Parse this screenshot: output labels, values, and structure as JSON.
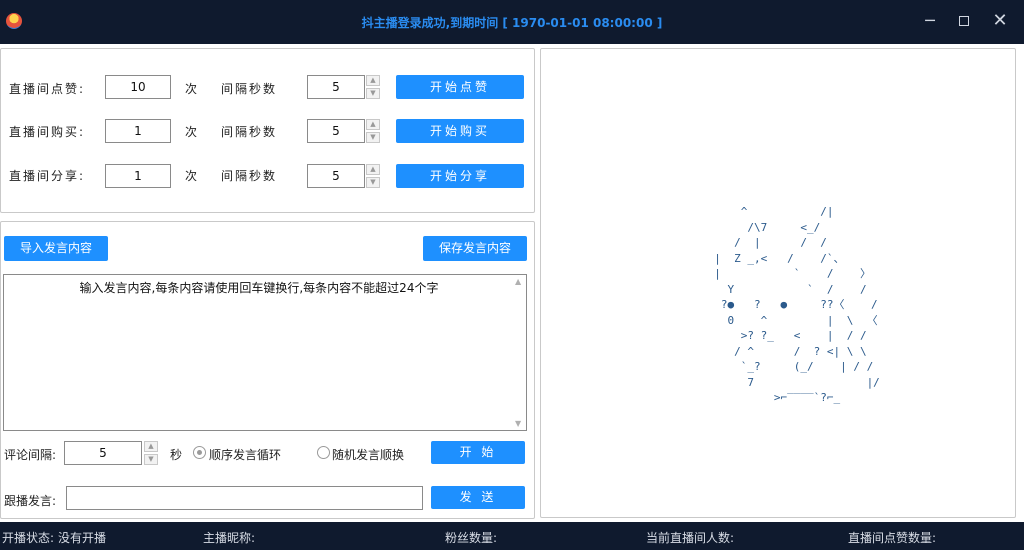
{
  "window": {
    "title": "抖主播登录成功,到期时间 [ 1970-01-01 08:00:00 ]",
    "minimize": "─",
    "close": "✕"
  },
  "controls": {
    "like": {
      "label": "直播间点赞:",
      "count": "10",
      "unit": "次",
      "interval_label": "间隔秒数",
      "interval": "5",
      "button": "开始点赞"
    },
    "buy": {
      "label": "直播间购买:",
      "count": "1",
      "unit": "次",
      "interval_label": "间隔秒数",
      "interval": "5",
      "button": "开始购买"
    },
    "share": {
      "label": "直播间分享:",
      "count": "1",
      "unit": "次",
      "interval_label": "间隔秒数",
      "interval": "5",
      "button": "开始分享"
    }
  },
  "comments": {
    "import_button": "导入发言内容",
    "save_button": "保存发言内容",
    "placeholder": "输入发言内容,每条内容请使用回车键换行,每条内容不能超过24个字",
    "interval_label": "评论间隔:",
    "interval_value": "5",
    "interval_unit": "秒",
    "mode_sequential": "顺序发言循环",
    "mode_random": "随机发言顺换",
    "mode_selected": "sequential",
    "start_button": "开 始",
    "follow_label": "跟播发言:",
    "follow_value": "",
    "send_button": "发 送"
  },
  "preview": {
    "ascii_art": "      ^           /|\n       /\\7     <_/\n     /  |      /  /\n  |  Z _,<   /    /`、\n  |           `    /    〉\n    Y           `  /    /\n   ?●   ?   ●     ??〈    /\n    0    ^         |  \\  〈\n      >? ?_   <    |  / /\n     / ^      /  ? <| \\ \\\n      `_?     (_/    | / /\n       7                 |/\n           >⌐‾‾‾‾`?⌐_"
  },
  "status": {
    "live_status_label": "开播状态:",
    "live_status_value": "没有开播",
    "anchor_name_label": "主播昵称:",
    "anchor_name_value": "",
    "fans_label": "粉丝数量:",
    "fans_value": "",
    "viewers_label": "当前直播间人数:",
    "viewers_value": "",
    "likes_label": "直播间点赞数量:",
    "likes_value": ""
  },
  "colors": {
    "accent": "#1e90ff",
    "titlebar": "#0f1a2e",
    "title_text": "#2a8cf0"
  }
}
